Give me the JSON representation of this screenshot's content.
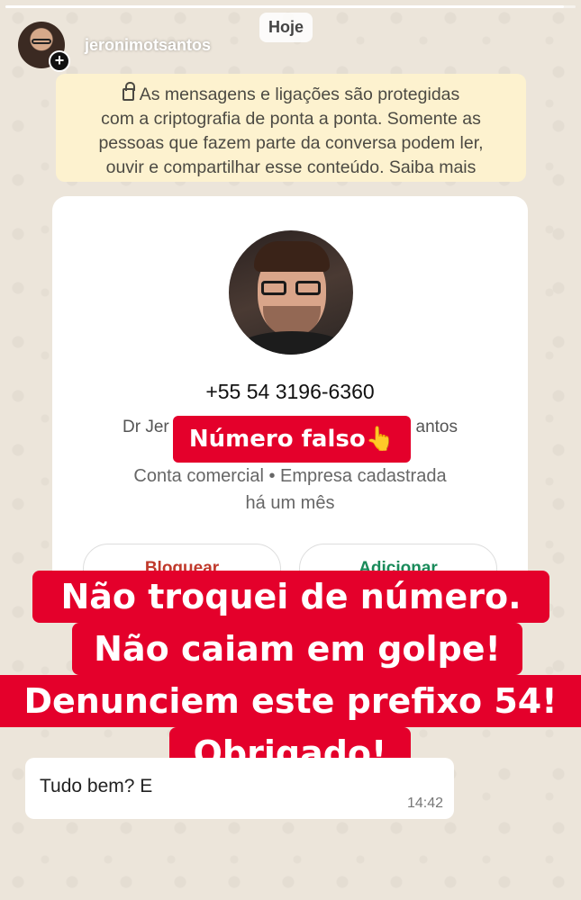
{
  "story": {
    "username": "jeronimotsantos",
    "date_chip": "Hoje",
    "progress": 0.98
  },
  "encryption_notice": {
    "line1": "As mensagens e ligações são protegidas",
    "line2": "com a criptografia de ponta a ponta. Somente as",
    "line3": "pessoas que fazem parte da conversa podem ler,",
    "line4": "ouvir e compartilhar esse conteúdo. Saiba mais"
  },
  "contact": {
    "number": "+55 54 3196-6360",
    "name_left": "Dr Jer",
    "name_right": "antos",
    "type_line1": "Conta comercial • Empresa cadastrada",
    "type_line2": "há um mês",
    "block_label": "Bloquear",
    "add_label": "Adicionar"
  },
  "overlay": {
    "fake_label": "Número falso👆",
    "warning_lines": [
      "Não troquei de número.",
      "Não caiam em golpe!",
      "Denunciem este prefixo 54!",
      "Obrigado!"
    ]
  },
  "message": {
    "text": "Tudo bem? E",
    "time": "14:42"
  }
}
